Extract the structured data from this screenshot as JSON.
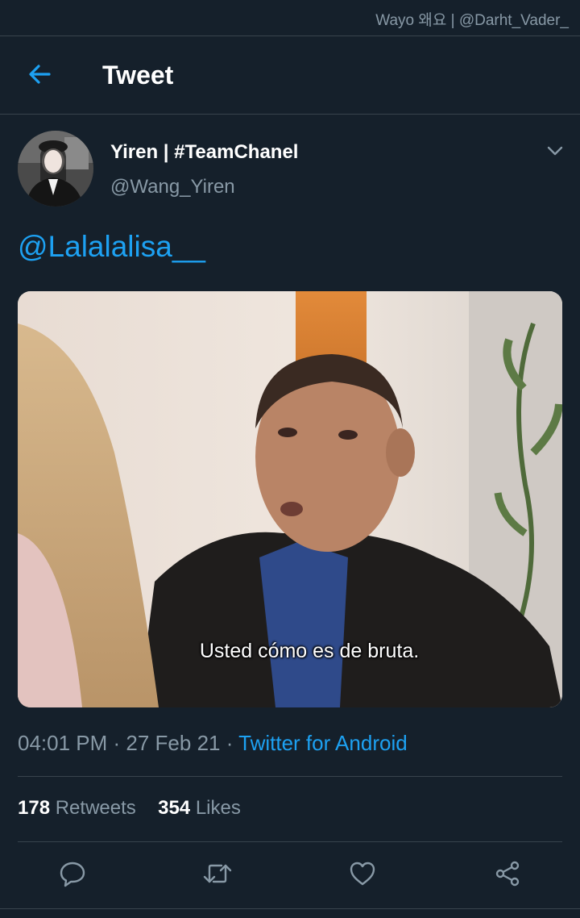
{
  "watermark": "Wayo 왜요 | @Darht_Vader_",
  "header": {
    "title": "Tweet",
    "back_icon": "arrow-left-icon"
  },
  "tweet": {
    "display_name": "Yiren | #TeamChanel",
    "handle": "@Wang_Yiren",
    "text": "@Lalalalisa__",
    "media_caption": "Usted cómo es de bruta.",
    "time": "04:01 PM",
    "date": "27 Feb 21",
    "source": "Twitter for Android",
    "retweet_count": "178",
    "retweet_label": "Retweets",
    "like_count": "354",
    "like_label": "Likes"
  },
  "actions": [
    "reply-icon",
    "retweet-icon",
    "like-icon",
    "share-icon"
  ],
  "colors": {
    "background": "#15202b",
    "accent": "#1da1f2",
    "muted": "#8899a6",
    "divider": "#38444d"
  }
}
